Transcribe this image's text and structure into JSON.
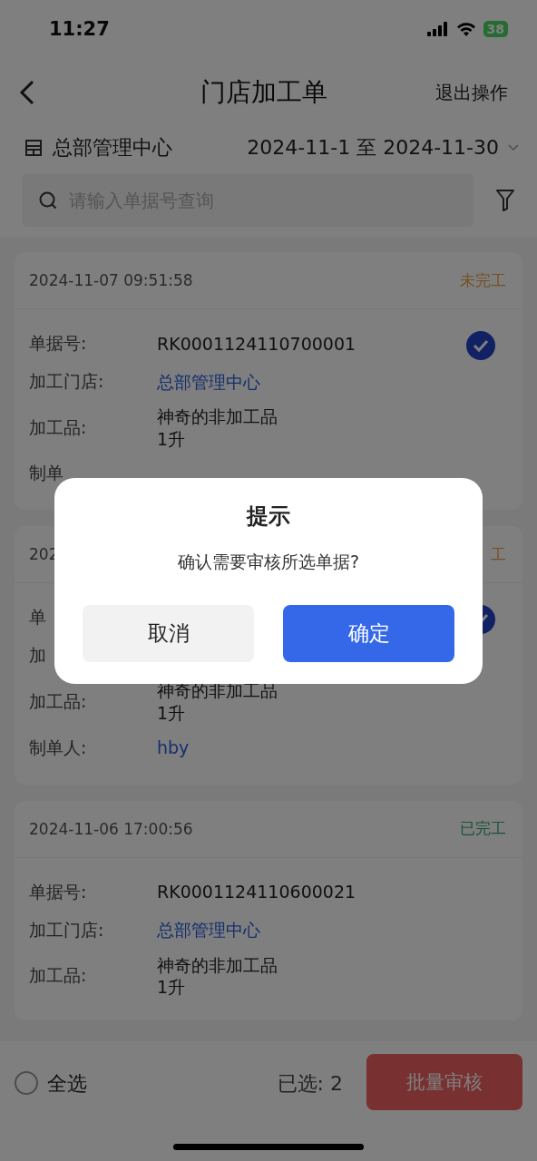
{
  "status_bar": {
    "time": "11:27",
    "battery": "38"
  },
  "nav": {
    "title": "门店加工单",
    "action": "退出操作"
  },
  "filter": {
    "store": "总部管理中心",
    "date_range": "2024-11-1 至 2024-11-30"
  },
  "search": {
    "placeholder": "请输入单据号查询"
  },
  "orders": [
    {
      "time": "2024-11-07 09:51:58",
      "status": "未完工",
      "kind": "pending",
      "selected": true,
      "fields": [
        {
          "label": "单据号:",
          "lines": [
            "RK0001124110700001"
          ],
          "kind": "plain"
        },
        {
          "label": "加工门店:",
          "lines": [
            "总部管理中心"
          ],
          "kind": "link"
        },
        {
          "label": "加工品:",
          "lines": [
            "神奇的非加工品",
            "1升"
          ],
          "kind": "plain"
        },
        {
          "label": "制单"
        }
      ]
    },
    {
      "time": "202",
      "status": "工",
      "kind": "pending",
      "selected": true,
      "fields": [
        {
          "label": "单"
        },
        {
          "label": "加"
        },
        {
          "label": "加工品:",
          "lines": [
            "神奇的非加工品",
            "1升"
          ],
          "kind": "plain"
        },
        {
          "label": "制单人:",
          "lines": [
            "hby"
          ],
          "kind": "link"
        }
      ]
    },
    {
      "time": "2024-11-06 17:00:56",
      "status": "已完工",
      "kind": "done",
      "selected": false,
      "fields": [
        {
          "label": "单据号:",
          "lines": [
            "RK0001124110600021"
          ],
          "kind": "plain"
        },
        {
          "label": "加工门店:",
          "lines": [
            "总部管理中心"
          ],
          "kind": "link"
        },
        {
          "label": "加工品:",
          "lines": [
            "神奇的非加工品",
            "1升"
          ],
          "kind": "plain"
        }
      ]
    }
  ],
  "bottom_bar": {
    "select_all": {
      "label": "全选",
      "checked": false
    },
    "selected_count": "已选: 2",
    "button": "批量审核"
  },
  "dialog": {
    "title": "提示",
    "message": "确认需要审核所选单据?",
    "buttons": [
      {
        "label": "取消",
        "kind": "cancel"
      },
      {
        "label": "确定",
        "kind": "confirm"
      }
    ]
  }
}
